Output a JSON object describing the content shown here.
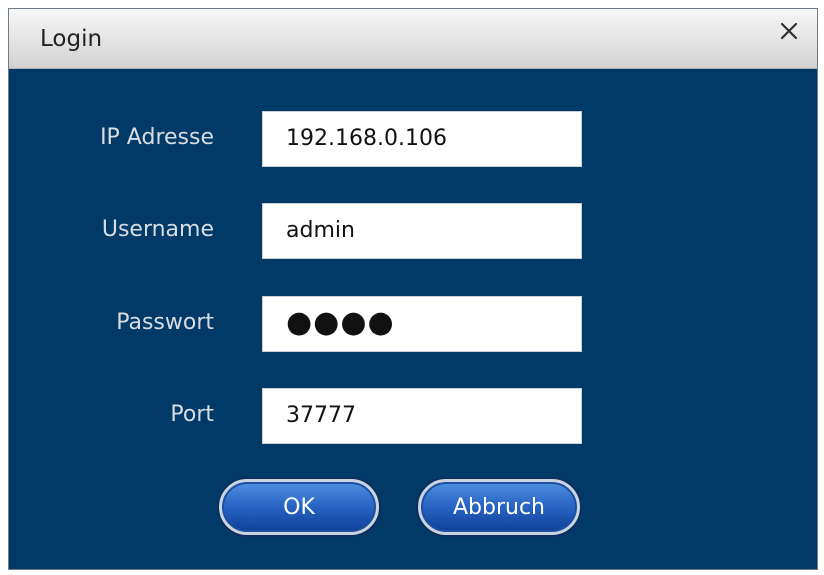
{
  "window": {
    "title": "Login",
    "close_icon": "close-icon"
  },
  "form": {
    "ip": {
      "label": "IP Adresse",
      "value": "192.168.0.106"
    },
    "username": {
      "label": "Username",
      "value": "admin"
    },
    "password": {
      "label": "Passwort",
      "value": "●●●●"
    },
    "port": {
      "label": "Port",
      "value": "37777"
    }
  },
  "buttons": {
    "ok_label": "OK",
    "cancel_label": "Abbruch"
  },
  "colors": {
    "dialog_background": "#013a66",
    "titlebar_top": "#f7f7f7",
    "titlebar_bottom": "#d2d2d2",
    "label_text": "#d8dde3",
    "button_blue": "#2a67c6"
  }
}
